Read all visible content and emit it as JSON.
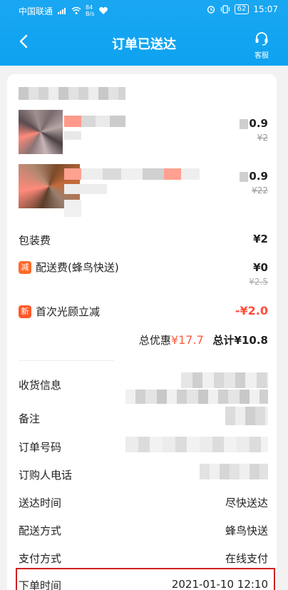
{
  "status_bar": {
    "carrier": "中国联通",
    "speed_value": "84",
    "speed_unit": "B/s",
    "battery": "62",
    "time": "15:07"
  },
  "header": {
    "title": "订单已送达",
    "service_label": "客服",
    "accent": "#0ea2f0"
  },
  "items": [
    {
      "price": "0.9",
      "original_price": "¥2"
    },
    {
      "price": "0.9",
      "original_price": "¥22"
    }
  ],
  "fees": {
    "packaging_label": "包装费",
    "packaging_value": "¥2",
    "delivery_tag": "减",
    "delivery_label": "配送费(蜂鸟快送)",
    "delivery_value": "¥0",
    "delivery_original": "¥2.5",
    "first_tag": "新",
    "first_label": "首次光顾立减",
    "first_value": "-¥2.0"
  },
  "totals": {
    "discount_label": "总优惠",
    "discount_value": "¥17.7",
    "total_label": "总计",
    "total_value": "¥10.8"
  },
  "info": {
    "address_label": "收货信息",
    "note_label": "备注",
    "order_no_label": "订单号码",
    "phone_label": "订购人电话",
    "delivery_time_label": "送达时间",
    "delivery_time_value": "尽快送达",
    "delivery_method_label": "配送方式",
    "delivery_method_value": "蜂鸟快送",
    "payment_label": "支付方式",
    "payment_value": "在线支付",
    "order_time_label": "下单时间",
    "order_time_value": "2021-01-10 12:10"
  }
}
